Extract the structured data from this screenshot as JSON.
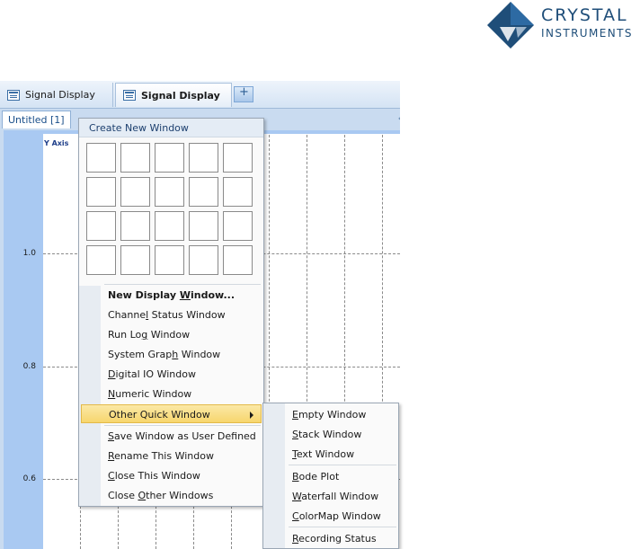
{
  "logo": {
    "line1": "CRYSTAL",
    "line2": "INSTRUMENTS"
  },
  "tabs": [
    {
      "label": "Signal Display"
    },
    {
      "label": "Signal Display"
    }
  ],
  "subtab": {
    "label": "Untitled [1]",
    "scroll_glyph": "‹"
  },
  "chart": {
    "y_axis_title": "Y Axis",
    "y_ticks": [
      "1.0",
      "0.8",
      "0.6"
    ]
  },
  "menu": {
    "header": "Create New Window",
    "items": [
      {
        "label": "New Display Window...",
        "u": "W"
      },
      {
        "label": "Channel Status Window",
        "u": "l"
      },
      {
        "label": "Run Log Window",
        "u": "g"
      },
      {
        "label": "System Graph Window",
        "u": "h"
      },
      {
        "label": "Digital IO Window",
        "u": "D"
      },
      {
        "label": "Numeric Window",
        "u": "N"
      },
      {
        "label": "Other Quick Window",
        "u": ""
      },
      {
        "label": "Save Window as User Defined",
        "u": "S"
      },
      {
        "label": "Rename This Window",
        "u": "R"
      },
      {
        "label": "Close This Window",
        "u": "C"
      },
      {
        "label": "Close Other Windows",
        "u": "O"
      }
    ]
  },
  "submenu": {
    "items": [
      {
        "label": "Empty Window",
        "u": "E"
      },
      {
        "label": "Stack Window",
        "u": "S"
      },
      {
        "label": "Text Window",
        "u": "T"
      },
      {
        "label": "Bode Plot",
        "u": "B"
      },
      {
        "label": "Waterfall Window",
        "u": "W"
      },
      {
        "label": "ColorMap Window",
        "u": "C"
      },
      {
        "label": "Recording Status",
        "u": "R"
      }
    ]
  },
  "colors": {
    "highlight": "#f7d66d",
    "chart_background": "#a9c9f2",
    "brand": "#1f4e79"
  }
}
